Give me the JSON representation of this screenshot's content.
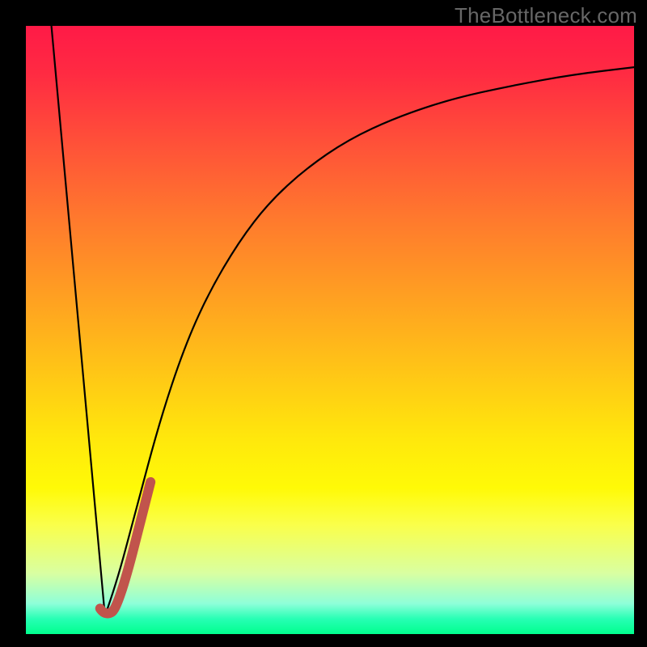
{
  "watermark": "TheBottleneck.com",
  "chart_data": {
    "type": "line",
    "title": "",
    "xlabel": "",
    "ylabel": "",
    "xlim": [
      0,
      100
    ],
    "ylim": [
      0,
      100
    ],
    "grid": false,
    "series": [
      {
        "name": "left-descent",
        "values": [
          {
            "x": 4.2,
            "y": 100
          },
          {
            "x": 13.0,
            "y": 3
          }
        ],
        "stroke": "#000000",
        "width": 2.2
      },
      {
        "name": "right-curve",
        "values": [
          {
            "x": 13.0,
            "y": 3
          },
          {
            "x": 14.8,
            "y": 8
          },
          {
            "x": 18.0,
            "y": 20
          },
          {
            "x": 22.0,
            "y": 35
          },
          {
            "x": 26.0,
            "y": 47
          },
          {
            "x": 30.0,
            "y": 56
          },
          {
            "x": 35.0,
            "y": 64.5
          },
          {
            "x": 40.0,
            "y": 71
          },
          {
            "x": 46.0,
            "y": 76.5
          },
          {
            "x": 53.0,
            "y": 81.3
          },
          {
            "x": 61.0,
            "y": 85
          },
          {
            "x": 70.0,
            "y": 88
          },
          {
            "x": 80.0,
            "y": 90.2
          },
          {
            "x": 90.0,
            "y": 92
          },
          {
            "x": 100.0,
            "y": 93.2
          }
        ],
        "stroke": "#000000",
        "width": 2.2
      },
      {
        "name": "highlight-segment",
        "values": [
          {
            "x": 12.2,
            "y": 4.2
          },
          {
            "x": 13.0,
            "y": 3.0
          },
          {
            "x": 15.2,
            "y": 4.2
          },
          {
            "x": 20.5,
            "y": 25.0
          }
        ],
        "stroke": "#c1544c",
        "width": 12
      }
    ],
    "background_gradient": {
      "type": "vertical",
      "stops": [
        {
          "pos": 0.0,
          "color": "#ff1a47"
        },
        {
          "pos": 0.35,
          "color": "#ff8a27"
        },
        {
          "pos": 0.7,
          "color": "#ffee0a"
        },
        {
          "pos": 0.9,
          "color": "#d9ffa1"
        },
        {
          "pos": 1.0,
          "color": "#00ff8e"
        }
      ]
    }
  }
}
